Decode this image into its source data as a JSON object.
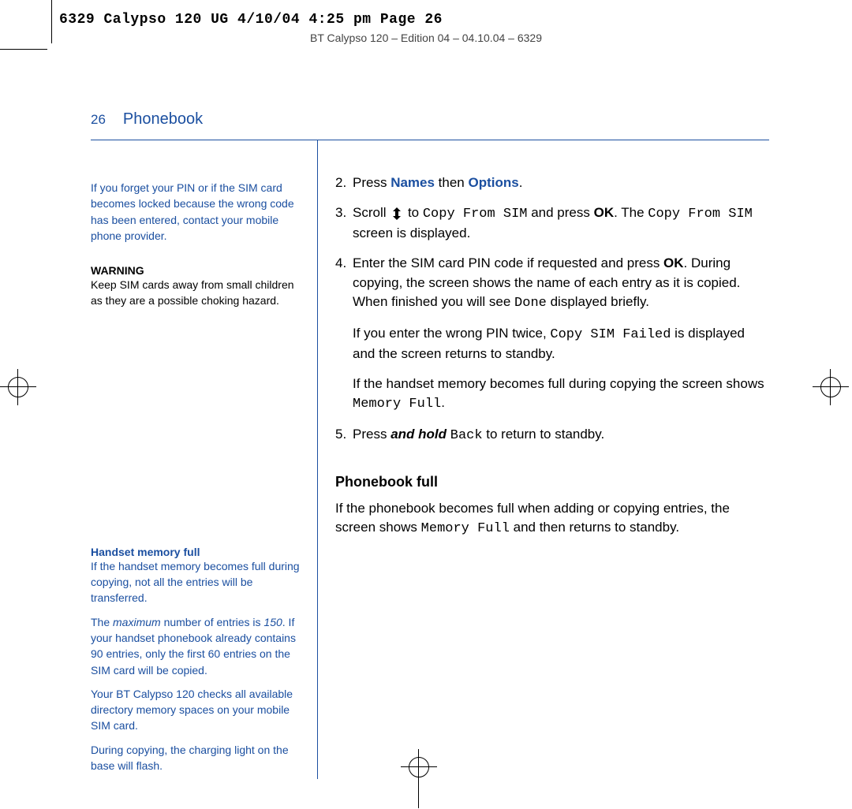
{
  "print_header": "6329 Calypso 120 UG   4/10/04  4:25 pm  Page 26",
  "edition_line": "BT Calypso 120 – Edition 04 – 04.10.04 – 6329",
  "page_number": "26",
  "page_title": "Phonebook",
  "sidebar": {
    "forgot_pin": "If you forget your PIN or if the SIM card becomes locked because the wrong code has been entered, contact your mobile phone provider.",
    "warning_heading": "WARNING",
    "warning_body": "Keep SIM cards away from small children as they are a possible choking hazard.",
    "mem_heading": "Handset memory full",
    "mem_p1": "If the handset memory becomes full during copying, not all the entries will be transferred.",
    "mem_p2_a": "The ",
    "mem_p2_max": "maximum",
    "mem_p2_b": " number of entries is ",
    "mem_p2_150": "150",
    "mem_p2_c": ". If your handset phonebook already contains 90 entries, only the first 60 entries on the SIM card will be copied.",
    "mem_p3": "Your BT Calypso 120 checks all available directory memory spaces on your mobile SIM card.",
    "mem_p4": "During copying, the charging light on the base will flash."
  },
  "main": {
    "step2_a": "Press ",
    "step2_names": "Names",
    "step2_b": " then ",
    "step2_options": "Options",
    "step2_c": ".",
    "step3_a": "Scroll ",
    "step3_b": " to ",
    "step3_copyfromsim": "Copy From SIM",
    "step3_c": " and press ",
    "step3_ok": "OK",
    "step3_d": ". The ",
    "step3_copyfromsim2": "Copy From SIM",
    "step3_e": " screen is displayed.",
    "step4_a": "Enter the SIM card PIN code if requested and press ",
    "step4_ok": "OK",
    "step4_b": ". During copying, the screen shows the name of each entry as it is copied. When finished you will see ",
    "step4_done": "Done",
    "step4_c": " displayed briefly.",
    "step4_p2_a": "If you enter the wrong PIN twice, ",
    "step4_p2_fail": "Copy SIM Failed",
    "step4_p2_b": " is displayed and the screen returns to standby.",
    "step4_p3_a": "If the handset memory becomes full during copying the screen shows ",
    "step4_p3_mem": "Memory Full",
    "step4_p3_b": ".",
    "step5_a": "Press ",
    "step5_hold": "and hold",
    "step5_b": " ",
    "step5_back": "Back",
    "step5_c": " to return to standby.",
    "pbfull_heading": "Phonebook full",
    "pbfull_a": "If the phonebook becomes full when adding or copying entries, the screen shows ",
    "pbfull_mem": "Memory Full",
    "pbfull_b": " and then returns to standby."
  }
}
